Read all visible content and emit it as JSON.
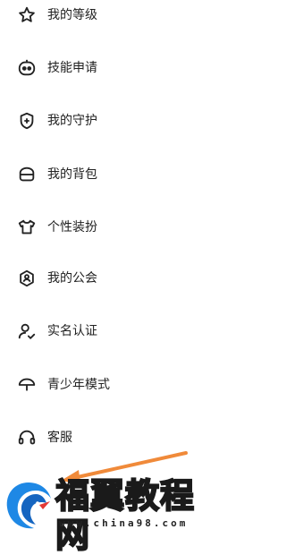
{
  "menu": {
    "items": [
      {
        "label": "我的等级",
        "icon": "star-outline-icon"
      },
      {
        "label": "技能申请",
        "icon": "robot-face-icon"
      },
      {
        "label": "我的守护",
        "icon": "shield-plus-icon"
      },
      {
        "label": "我的背包",
        "icon": "backpack-icon"
      },
      {
        "label": "个性装扮",
        "icon": "tshirt-icon"
      },
      {
        "label": "我的公会",
        "icon": "guild-badge-icon"
      },
      {
        "label": "实名认证",
        "icon": "user-check-icon"
      },
      {
        "label": "青少年模式",
        "icon": "umbrella-icon"
      },
      {
        "label": "客服",
        "icon": "headset-icon"
      }
    ]
  },
  "watermark": {
    "title": "福翼教程网",
    "url": "www.china98.com"
  },
  "colors": {
    "icon_stroke": "#222222",
    "arrow": "#f08a3a",
    "logo_blue": "#1e88e5",
    "logo_red": "#e53935"
  }
}
